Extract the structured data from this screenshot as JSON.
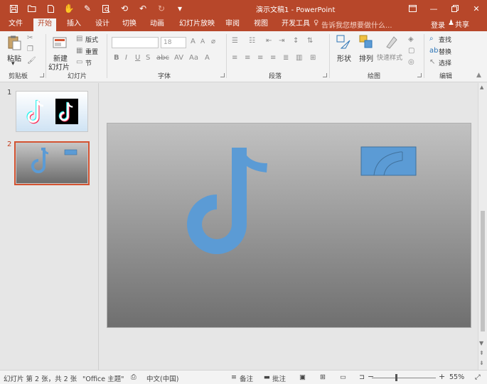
{
  "window": {
    "title": "演示文稿1 - PowerPoint",
    "tell_me": "告诉我您想要做什么...",
    "login": "登录",
    "share": "共享"
  },
  "tabs": [
    {
      "label": "文件"
    },
    {
      "label": "开始",
      "active": true
    },
    {
      "label": "插入"
    },
    {
      "label": "设计"
    },
    {
      "label": "切换"
    },
    {
      "label": "动画"
    },
    {
      "label": "幻灯片放映"
    },
    {
      "label": "审阅"
    },
    {
      "label": "视图"
    },
    {
      "label": "开发工具"
    }
  ],
  "ribbon": {
    "clipboard": {
      "label": "剪贴板",
      "paste": "粘贴"
    },
    "slides": {
      "label": "幻灯片",
      "new_slide_1": "新建",
      "new_slide_2": "幻灯片",
      "layout": "版式",
      "reset": "重置",
      "section": "节"
    },
    "font": {
      "label": "字体",
      "font_size": "18"
    },
    "paragraph": {
      "label": "段落"
    },
    "drawing": {
      "label": "绘图",
      "shapes": "形状",
      "arrange": "排列",
      "quick_styles": "快速样式"
    },
    "editing": {
      "label": "编辑",
      "find": "查找",
      "replace": "替换",
      "select": "选择"
    }
  },
  "thumbnails": [
    {
      "number": "1"
    },
    {
      "number": "2",
      "selected": true
    }
  ],
  "status": {
    "slide_info": "幻灯片 第 2 张，共 2 张",
    "theme": "\"Office 主题\"",
    "language": "中文(中国)",
    "notes": "备注",
    "comments": "批注",
    "zoom": "55%"
  },
  "colors": {
    "accent": "#b7472a",
    "shape_blue": "#5b9bd5",
    "shape_blue_border": "#41719c"
  },
  "icons": [
    "save-icon",
    "open-icon",
    "new-icon",
    "touch-icon",
    "spelling-icon",
    "preview-icon",
    "repeat-icon",
    "undo-icon",
    "redo-icon",
    "customize-icon",
    "restore-icon",
    "minimize-icon",
    "maximize-icon",
    "close-icon",
    "lightbulb-icon",
    "user-icon"
  ]
}
